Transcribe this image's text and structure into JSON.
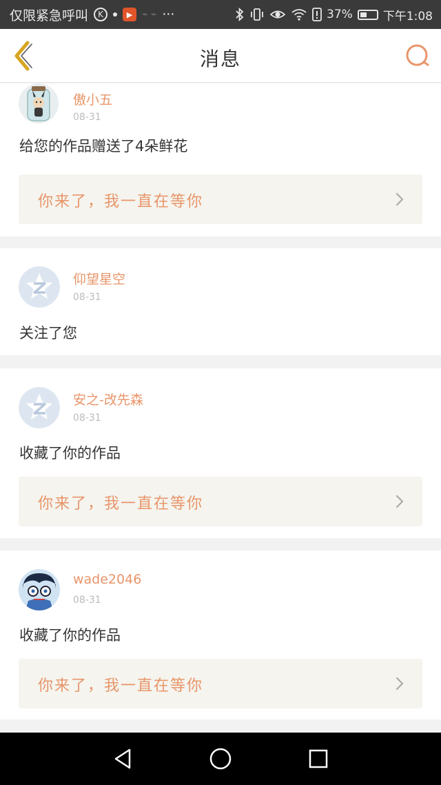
{
  "status_bar": {
    "carrier": "仅限紧急呼叫",
    "k_badge": "K",
    "app_icon": "▶",
    "faint_icons": "⌁ ⌁",
    "more": "···",
    "battery_percent": "37%",
    "time": "下午1:08",
    "icons": [
      "bluetooth-icon",
      "vibrate-icon",
      "eye-icon",
      "wifi-icon",
      "sim-alert-icon",
      "battery-icon"
    ]
  },
  "header": {
    "title": "消息",
    "back_icon": "chevron-left-icon",
    "search_icon": "search-icon",
    "accent_color": "#e8956a",
    "back_color": "#d9a520"
  },
  "messages": [
    {
      "username": "傲小五",
      "time": "08-31",
      "action": "给您的作品赠送了4朵鲜花",
      "quote": "你来了，我一直在等你",
      "avatar": "bottle-character"
    },
    {
      "username": "仰望星空",
      "time": "08-31",
      "action": "关注了您",
      "avatar": "default-qzone"
    },
    {
      "username": "安之-改先森",
      "time": "08-31",
      "action": "收藏了你的作品",
      "quote": "你来了，我一直在等你",
      "avatar": "default-qzone"
    },
    {
      "username": "wade2046",
      "time": "08-31",
      "action": "收藏了你的作品",
      "quote": "你来了，我一直在等你",
      "avatar": "anime-boy"
    }
  ],
  "nav": [
    "back-triangle-icon",
    "home-circle-icon",
    "recents-square-icon"
  ]
}
